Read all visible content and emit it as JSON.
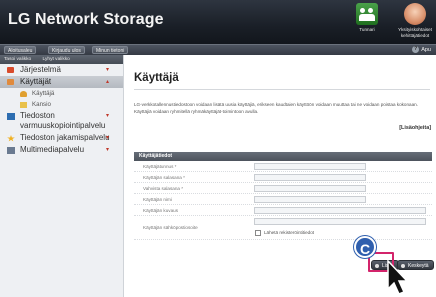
{
  "header": {
    "app_title": "LG Network Storage",
    "tools": [
      {
        "label": "Tunnari",
        "icon": "users-icon"
      },
      {
        "label": "Yksityiskohtaiset kehittäjätiedot",
        "icon": "settings-icon"
      }
    ]
  },
  "navbar": {
    "buttons": [
      "Aloitusaleu",
      "Kirjaudu ulos",
      "Minun tietoni"
    ],
    "help": "Apu"
  },
  "sidebar": {
    "top_links": [
      "Tasoi valikko",
      "Lyhyt valikko"
    ],
    "items": [
      {
        "label": "Järjestelmä",
        "icon": "system-icon",
        "color": "#d94b2b"
      },
      {
        "label": "Käyttäjät",
        "icon": "users-icon",
        "color": "#e08a3c",
        "active": true
      },
      {
        "label": "Käyttäjä",
        "icon": "user-icon",
        "color": "#e0a030"
      },
      {
        "label": "Kansio",
        "icon": "folder-icon",
        "color": "#e9c14a"
      },
      {
        "label": "Tiedoston varmuuskopiointipalvelu",
        "icon": "backup-icon",
        "color": "#2d6db0"
      },
      {
        "label": "Tiedoston jakamispalvelu",
        "icon": "share-icon",
        "color": "#f0b020"
      },
      {
        "label": "Multimediapalvelu",
        "icon": "media-icon",
        "color": "#6a7a90"
      }
    ]
  },
  "main": {
    "title": "Käyttäjä",
    "description": "LG-verkkotallennustiedostoon voidaan lisätä uusia käyttäjiä, erikseen kaudtaien käyttöön voidaan muuttaa tai ne voidaan poistaa kokonaan. Käyttäjiä voidaan ryhmitellä ryhmäkäyttäjät-toimintoon avulla.",
    "more_link": "[Lisäohjeita]",
    "panel_title": "Käyttäjätiedot",
    "fields": [
      {
        "label": "Käyttäjätunnus *"
      },
      {
        "label": "Käyttäjän salasana *"
      },
      {
        "label": "Vahvista salasana *"
      },
      {
        "label": "Käyttäjän nimi"
      },
      {
        "label": "Käyttäjän kuvaus"
      },
      {
        "label": "Käyttäjän sähköpostiosoite"
      }
    ],
    "send_notice_label": "Lähetä rekisteröintitiedot",
    "buttons": {
      "add": "Lisää",
      "cancel": "Keskeytä"
    }
  },
  "annotation": {
    "marker_letter": "C"
  }
}
